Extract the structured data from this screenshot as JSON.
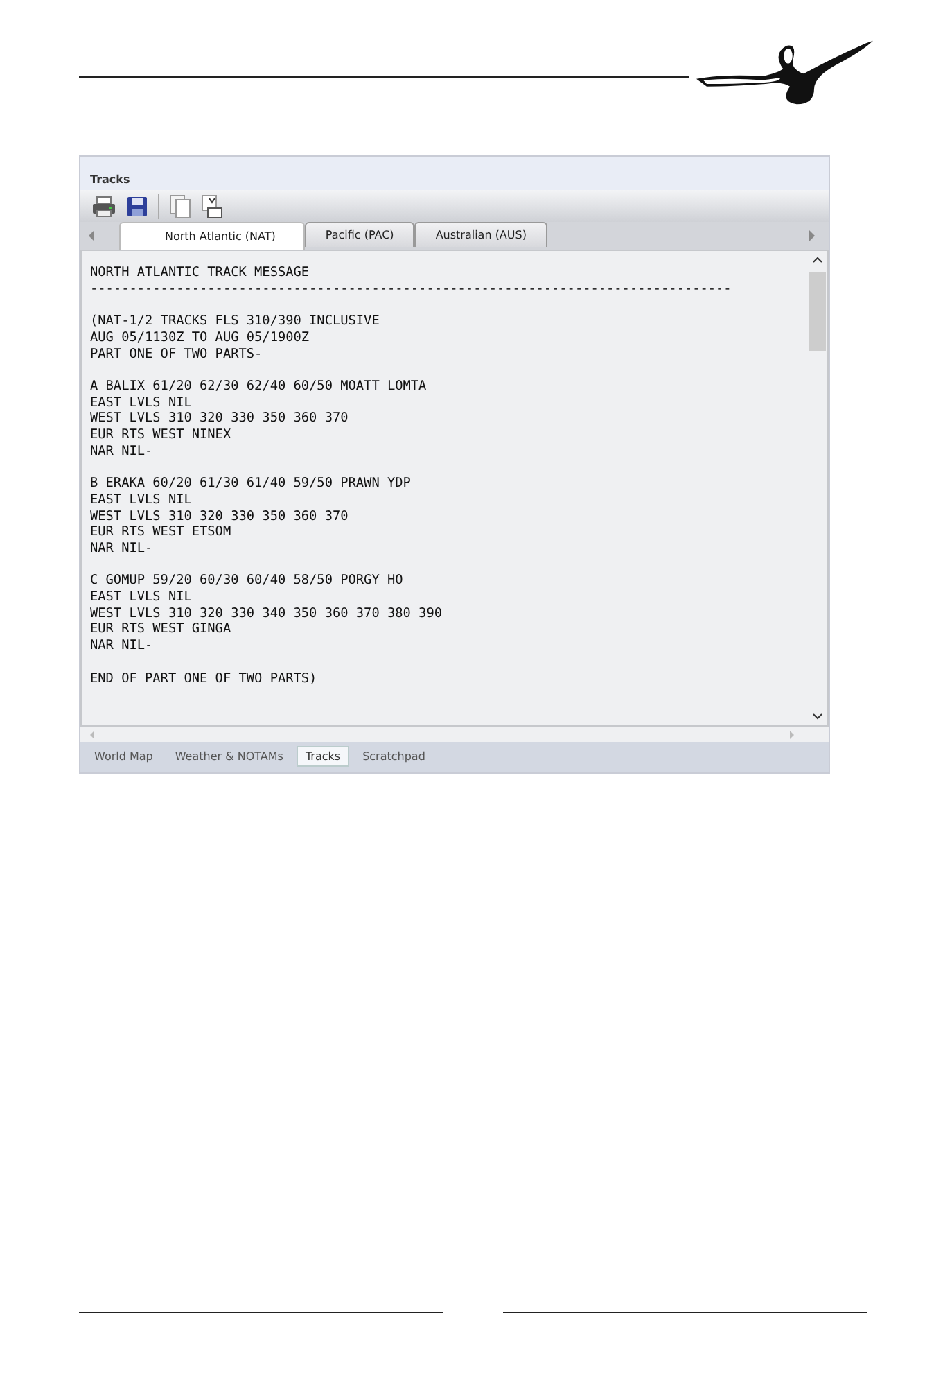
{
  "panel": {
    "title": "Tracks"
  },
  "tabs": [
    {
      "label": "North Atlantic (NAT)",
      "selected": true
    },
    {
      "label": "Pacific (PAC)",
      "selected": false
    },
    {
      "label": "Australian (AUS)",
      "selected": false
    }
  ],
  "message": [
    [
      "NORTH ATLANTIC TRACK MESSAGE",
      "----------------------------------------------------------------------------------"
    ],
    [
      "(NAT-1/2 TRACKS FLS 310/390 INCLUSIVE",
      "AUG 05/1130Z TO AUG 05/1900Z",
      "PART ONE OF TWO PARTS-"
    ],
    [
      "A BALIX 61/20 62/30 62/40 60/50 MOATT LOMTA",
      "EAST LVLS NIL",
      "WEST LVLS 310 320 330 350 360 370",
      "EUR RTS WEST NINEX",
      "NAR NIL-"
    ],
    [
      "B ERAKA 60/20 61/30 61/40 59/50 PRAWN YDP",
      "EAST LVLS NIL",
      "WEST LVLS 310 320 330 350 360 370",
      "EUR RTS WEST ETSOM",
      "NAR NIL-"
    ],
    [
      "C GOMUP 59/20 60/30 60/40 58/50 PORGY HO",
      "EAST LVLS NIL",
      "WEST LVLS 310 320 330 340 350 360 370 380 390",
      "EUR RTS WEST GINGA",
      "NAR NIL-"
    ],
    [
      "END OF PART ONE OF TWO PARTS)"
    ]
  ],
  "bottom_tabs": [
    {
      "label": "World Map",
      "selected": false
    },
    {
      "label": "Weather & NOTAMs",
      "selected": false
    },
    {
      "label": "Tracks",
      "selected": true
    },
    {
      "label": "Scratchpad",
      "selected": false
    }
  ]
}
